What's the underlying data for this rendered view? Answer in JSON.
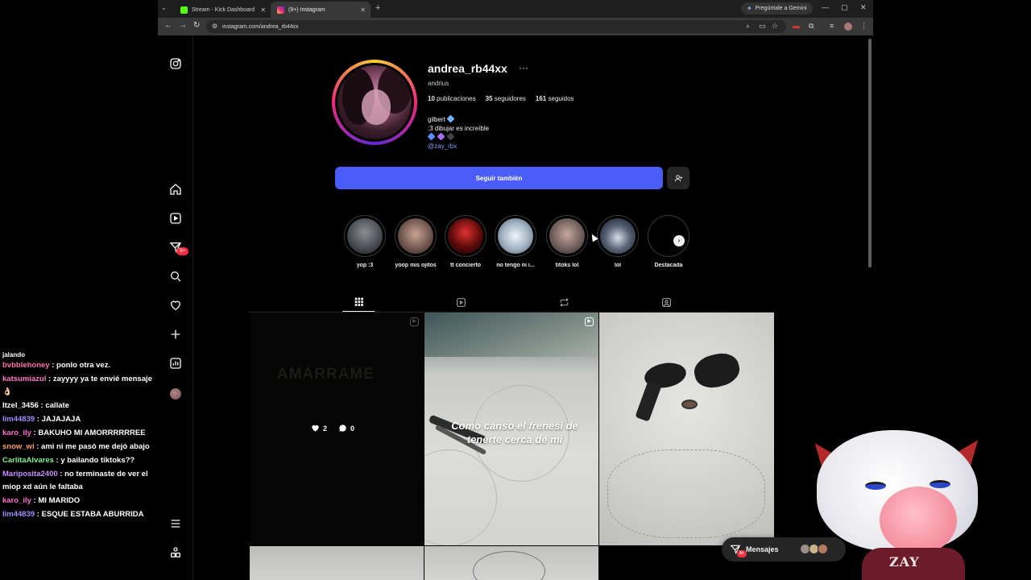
{
  "browser": {
    "tabs": [
      {
        "title": "Stream - Kick Dashboard",
        "active": false
      },
      {
        "title": "(9+) Instagram",
        "active": true
      }
    ],
    "gemini_label": "Pregúntale a Gemini",
    "url": "instagram.com/andrea_rb44xx"
  },
  "sidebar": {
    "notification_badge": "9+"
  },
  "profile": {
    "username": "andrea_rb44xx",
    "full_name": "andrius",
    "stats": {
      "posts_count": "10",
      "posts_label": "publicaciones",
      "followers_count": "35",
      "followers_label": "seguidores",
      "following_count": "161",
      "following_label": "seguidos"
    },
    "bio": {
      "line1": "gilbert",
      "line2": ":3 dibujar es increíble",
      "link": "@zay_rbx"
    },
    "follow_button": "Seguir también",
    "colors": {
      "follow_button": "#4a5df9",
      "link": "#839fff",
      "badge": "#ff3040"
    }
  },
  "highlights": [
    {
      "label": "yop :3"
    },
    {
      "label": "yoop mis ojitos"
    },
    {
      "label": "tt concierto"
    },
    {
      "label": "no tengo ni i..."
    },
    {
      "label": "titoks lol"
    },
    {
      "label": "lol"
    },
    {
      "label": "Destacada"
    }
  ],
  "posts": {
    "first": {
      "ghost_text": "AMÁRRAME",
      "likes": "2",
      "comments": "0"
    },
    "second": {
      "lyric": "Como canso el frenesí de tenerte cerca de mí"
    }
  },
  "messages": {
    "label": "Mensajes",
    "badge": "9+"
  },
  "chat": {
    "partial_line": "jalando",
    "messages": [
      {
        "user": "bvbblehoney",
        "color": "#ff6fb0",
        "text": "ponlo otra vez."
      },
      {
        "user": "katsumiazul",
        "color": "#ff79c6",
        "text": "zayyyy ya te envié mensaje 👌🏻"
      },
      {
        "user": "Itzel_3456",
        "color": "#ffffff",
        "text": "callate"
      },
      {
        "user": "lim44839",
        "color": "#a48bff",
        "text": "JAJAJAJA"
      },
      {
        "user": "karo_ily",
        "color": "#ff6fd1",
        "text": "BAKUHO MI AMORRRRRREE"
      },
      {
        "user": "snow_wi",
        "color": "#ff9f6b",
        "text": "ami ni me pasó me dejó abajo"
      },
      {
        "user": "CarlitaAlvares",
        "color": "#7cf28a",
        "text": "y bailando tiktoks??"
      },
      {
        "user": "Mariposita2400",
        "color": "#c98bff",
        "text": "no terminaste de ver el miop xd aún le faltaba"
      },
      {
        "user": "karo_ily",
        "color": "#ff6fd1",
        "text": "MI MARIDO"
      },
      {
        "user": "lim44839",
        "color": "#a48bff",
        "text": "ESQUE ESTABA ABURRIDA"
      }
    ]
  },
  "overlay": {
    "shirt_logo": "ZAY"
  }
}
